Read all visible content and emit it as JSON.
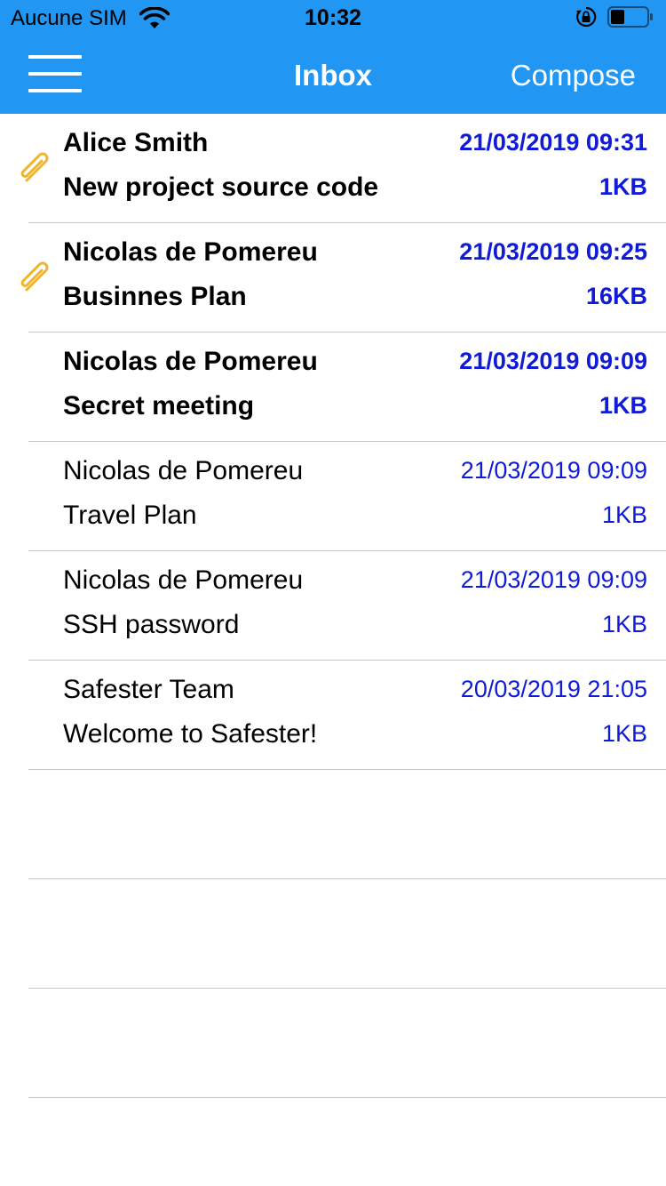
{
  "status_bar": {
    "carrier": "Aucune SIM",
    "time": "10:32",
    "icons": [
      "wifi-icon",
      "orientation-lock-icon",
      "battery-icon"
    ]
  },
  "nav": {
    "menu_icon": "hamburger-menu-icon",
    "title": "Inbox",
    "compose_label": "Compose"
  },
  "colors": {
    "header": "#2196f3",
    "date_text": "#0f1bd6",
    "attachment_icon": "#f0b429",
    "separator": "#c7c7cc"
  },
  "messages": [
    {
      "sender": "Alice Smith",
      "subject": "New project source code",
      "date": "21/03/2019 09:31",
      "size": "1KB",
      "unread": true,
      "attachment": true
    },
    {
      "sender": "Nicolas de Pomereu",
      "subject": "Businnes Plan",
      "date": "21/03/2019 09:25",
      "size": "16KB",
      "unread": true,
      "attachment": true
    },
    {
      "sender": "Nicolas de Pomereu",
      "subject": "Secret meeting",
      "date": "21/03/2019 09:09",
      "size": "1KB",
      "unread": true,
      "attachment": false
    },
    {
      "sender": "Nicolas de Pomereu",
      "subject": "Travel Plan",
      "date": "21/03/2019 09:09",
      "size": "1KB",
      "unread": false,
      "attachment": false
    },
    {
      "sender": "Nicolas de Pomereu",
      "subject": "SSH password",
      "date": "21/03/2019 09:09",
      "size": "1KB",
      "unread": false,
      "attachment": false
    },
    {
      "sender": "Safester Team",
      "subject": "Welcome to Safester!",
      "date": "20/03/2019 21:05",
      "size": "1KB",
      "unread": false,
      "attachment": false
    }
  ]
}
